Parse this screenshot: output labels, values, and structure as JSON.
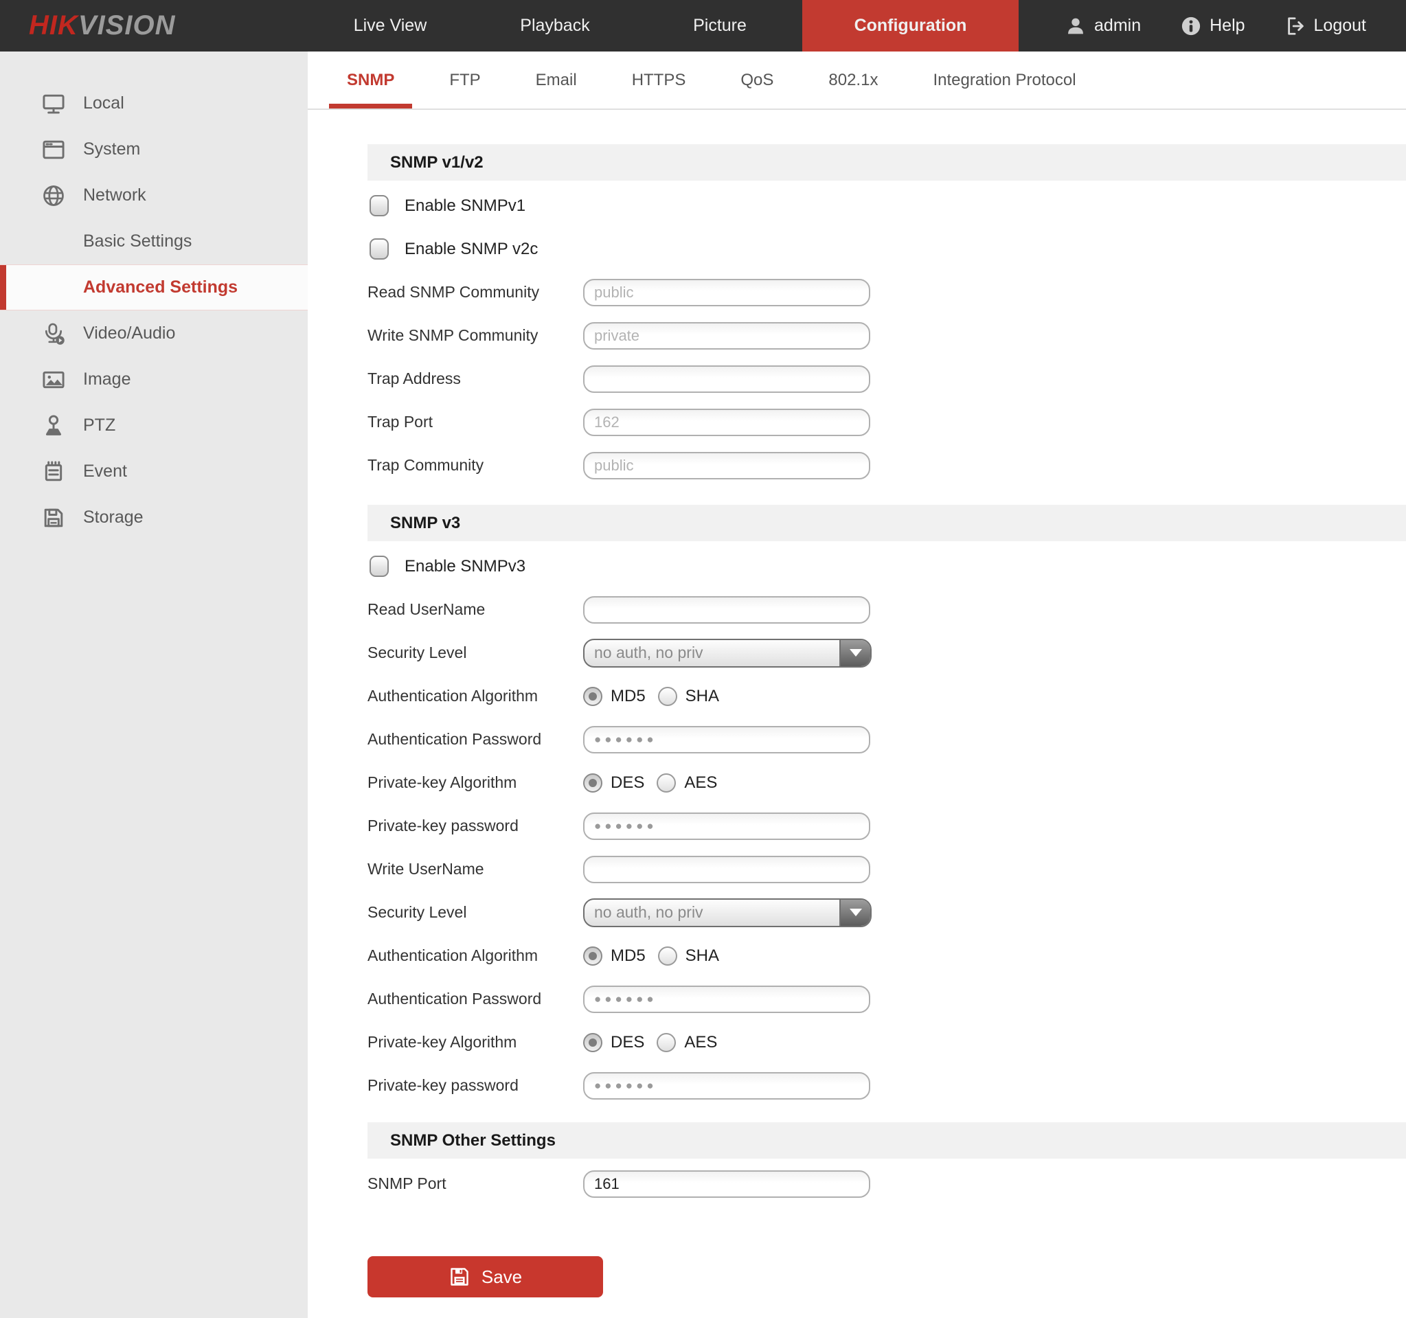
{
  "colors": {
    "accent_red": "#c23a30",
    "topbar_bg": "#303030",
    "sidebar_bg": "#e9e9e9",
    "section_header_bg": "#f1f1f1"
  },
  "topbar": {
    "logo_primary": "HIK",
    "logo_secondary": "VISION",
    "nav": [
      {
        "label": "Live View"
      },
      {
        "label": "Playback"
      },
      {
        "label": "Picture"
      },
      {
        "label": "Configuration",
        "active": true
      }
    ],
    "username": "admin",
    "help_label": "Help",
    "logout_label": "Logout"
  },
  "sidebar": {
    "items": [
      {
        "label": "Local",
        "icon": "monitor-icon"
      },
      {
        "label": "System",
        "icon": "window-icon"
      },
      {
        "label": "Network",
        "icon": "globe-icon"
      },
      {
        "label": "Basic Settings",
        "sub": true
      },
      {
        "label": "Advanced Settings",
        "sub": true,
        "active": true
      },
      {
        "label": "Video/Audio",
        "icon": "microphone-icon"
      },
      {
        "label": "Image",
        "icon": "image-icon"
      },
      {
        "label": "PTZ",
        "icon": "joystick-icon"
      },
      {
        "label": "Event",
        "icon": "notepad-icon"
      },
      {
        "label": "Storage",
        "icon": "floppy-icon"
      }
    ]
  },
  "tabs": {
    "active": "SNMP",
    "items": [
      {
        "label": "SNMP"
      },
      {
        "label": "FTP"
      },
      {
        "label": "Email"
      },
      {
        "label": "HTTPS"
      },
      {
        "label": "QoS"
      },
      {
        "label": "802.1x"
      },
      {
        "label": "Integration Protocol"
      }
    ]
  },
  "form": {
    "sections": [
      {
        "title": "SNMP v1/v2",
        "rows": [
          {
            "type": "checkbox",
            "label": "Enable SNMPv1",
            "checked": false
          },
          {
            "type": "checkbox",
            "label": "Enable SNMP v2c",
            "checked": false
          },
          {
            "type": "text",
            "label": "Read SNMP Community",
            "placeholder": "public",
            "value": ""
          },
          {
            "type": "text",
            "label": "Write SNMP Community",
            "placeholder": "private",
            "value": ""
          },
          {
            "type": "text",
            "label": "Trap Address",
            "placeholder": "",
            "value": ""
          },
          {
            "type": "text",
            "label": "Trap Port",
            "placeholder": "162",
            "value": ""
          },
          {
            "type": "text",
            "label": "Trap Community",
            "placeholder": "public",
            "value": ""
          }
        ]
      },
      {
        "title": "SNMP v3",
        "rows": [
          {
            "type": "checkbox",
            "label": "Enable SNMPv3",
            "checked": false
          },
          {
            "type": "text",
            "label": "Read UserName",
            "placeholder": "",
            "value": ""
          },
          {
            "type": "select",
            "label": "Security Level",
            "value": "no auth, no priv"
          },
          {
            "type": "radio",
            "label": "Authentication Algorithm",
            "options": [
              {
                "label": "MD5"
              },
              {
                "label": "SHA"
              }
            ],
            "selected": "MD5"
          },
          {
            "type": "password",
            "label": "Authentication Password",
            "value": "●●●●●●"
          },
          {
            "type": "radio",
            "label": "Private-key Algorithm",
            "options": [
              {
                "label": "DES"
              },
              {
                "label": "AES"
              }
            ],
            "selected": "DES"
          },
          {
            "type": "password",
            "label": "Private-key password",
            "value": "●●●●●●"
          },
          {
            "type": "text",
            "label": "Write UserName",
            "placeholder": "",
            "value": ""
          },
          {
            "type": "select",
            "label": "Security Level",
            "value": "no auth, no priv"
          },
          {
            "type": "radio",
            "label": "Authentication Algorithm",
            "options": [
              {
                "label": "MD5"
              },
              {
                "label": "SHA"
              }
            ],
            "selected": "MD5"
          },
          {
            "type": "password",
            "label": "Authentication Password",
            "value": "●●●●●●"
          },
          {
            "type": "radio",
            "label": "Private-key Algorithm",
            "options": [
              {
                "label": "DES"
              },
              {
                "label": "AES"
              }
            ],
            "selected": "DES"
          },
          {
            "type": "password",
            "label": "Private-key password",
            "value": "●●●●●●"
          }
        ]
      },
      {
        "title": "SNMP Other Settings",
        "rows": [
          {
            "type": "text",
            "label": "SNMP Port",
            "placeholder": "",
            "value": "161"
          }
        ]
      }
    ],
    "save_label": "Save"
  }
}
